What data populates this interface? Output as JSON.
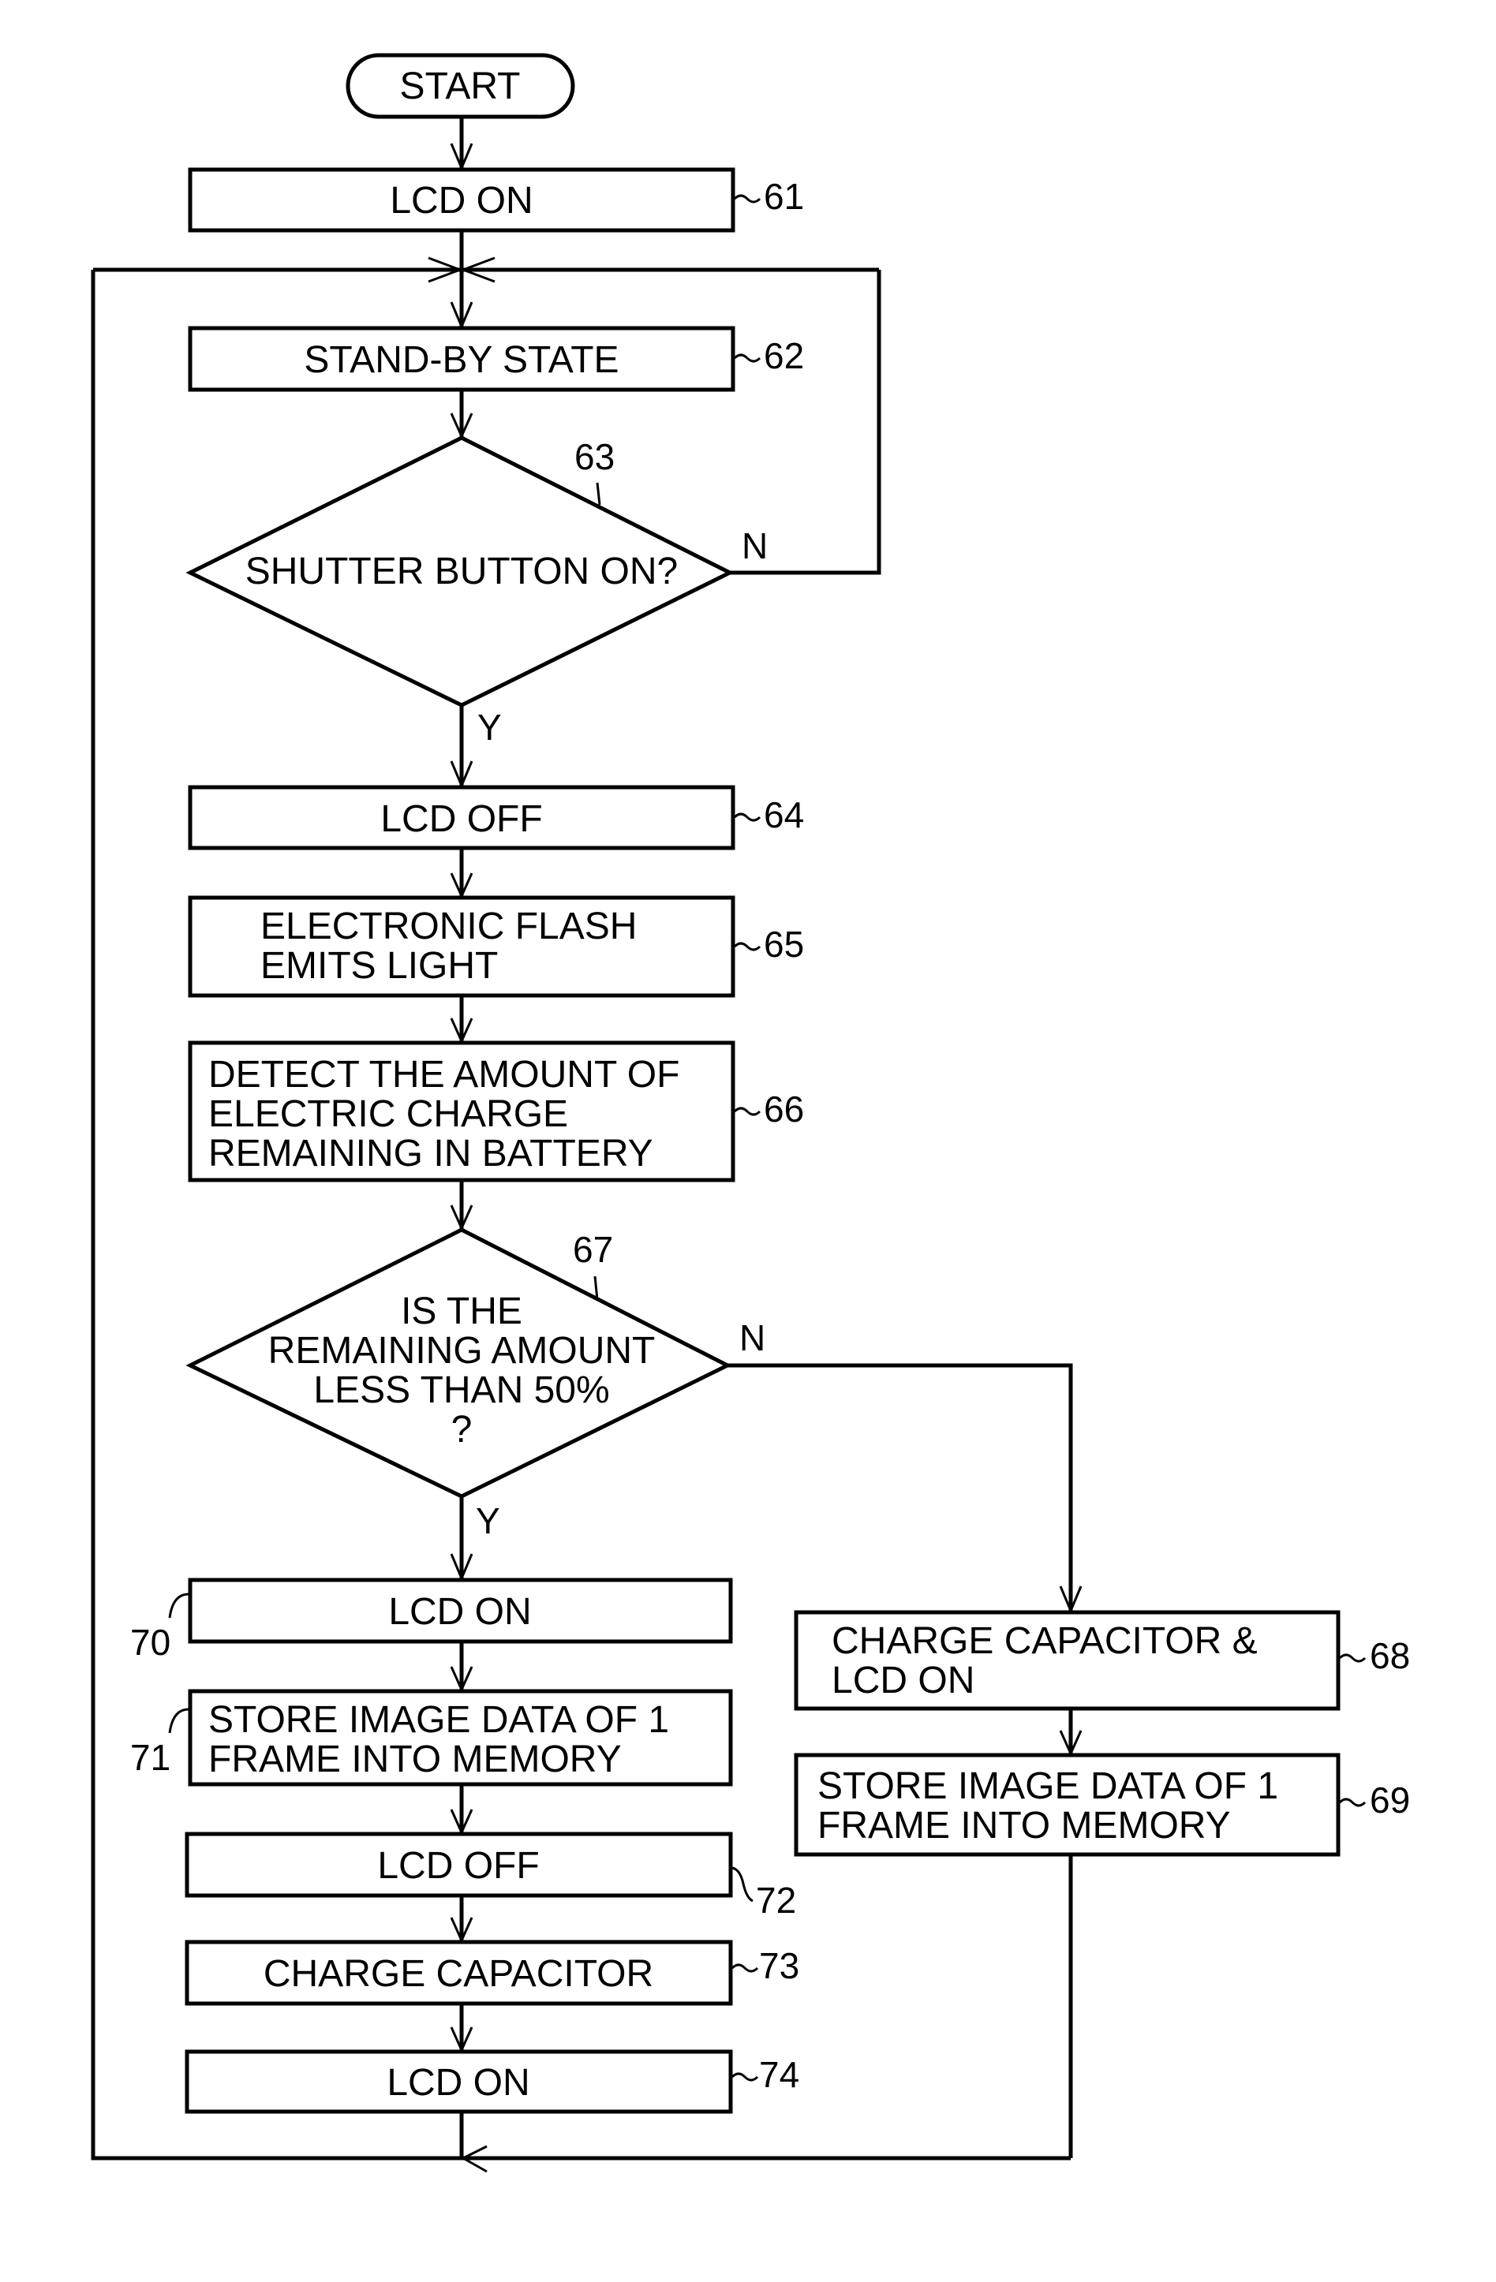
{
  "figure": {
    "type": "flowchart",
    "start": {
      "label": "START"
    },
    "steps": {
      "s61": {
        "ref": "61",
        "lines": [
          "LCD ON"
        ]
      },
      "s62": {
        "ref": "62",
        "lines": [
          "STAND-BY STATE"
        ]
      },
      "s63": {
        "ref": "63",
        "lines": [
          "SHUTTER BUTTON ON?"
        ],
        "yes": "Y",
        "no": "N"
      },
      "s64": {
        "ref": "64",
        "lines": [
          "LCD OFF"
        ]
      },
      "s65": {
        "ref": "65",
        "lines": [
          "ELECTRONIC FLASH",
          "EMITS LIGHT"
        ]
      },
      "s66": {
        "ref": "66",
        "lines": [
          "DETECT THE AMOUNT OF",
          "ELECTRIC CHARGE",
          "REMAINING IN BATTERY"
        ]
      },
      "s67": {
        "ref": "67",
        "lines": [
          "IS THE",
          "REMAINING AMOUNT",
          "LESS THAN 50%",
          "?"
        ],
        "yes": "Y",
        "no": "N"
      },
      "s68": {
        "ref": "68",
        "lines": [
          "CHARGE CAPACITOR &",
          "LCD ON"
        ]
      },
      "s69": {
        "ref": "69",
        "lines": [
          "STORE IMAGE DATA OF 1",
          "FRAME INTO MEMORY"
        ]
      },
      "s70": {
        "ref": "70",
        "lines": [
          "LCD ON"
        ]
      },
      "s71": {
        "ref": "71",
        "lines": [
          "STORE IMAGE DATA OF 1",
          "FRAME INTO MEMORY"
        ]
      },
      "s72": {
        "ref": "72",
        "lines": [
          "LCD OFF"
        ]
      },
      "s73": {
        "ref": "73",
        "lines": [
          "CHARGE CAPACITOR"
        ]
      },
      "s74": {
        "ref": "74",
        "lines": [
          "LCD ON"
        ]
      }
    },
    "edges": [
      {
        "from": "start",
        "to": "s61"
      },
      {
        "from": "s61",
        "to": "s62"
      },
      {
        "from": "s62",
        "to": "s63"
      },
      {
        "from": "s63",
        "to": "s62",
        "label": "N"
      },
      {
        "from": "s63",
        "to": "s64",
        "label": "Y"
      },
      {
        "from": "s64",
        "to": "s65"
      },
      {
        "from": "s65",
        "to": "s66"
      },
      {
        "from": "s66",
        "to": "s67"
      },
      {
        "from": "s67",
        "to": "s70",
        "label": "Y"
      },
      {
        "from": "s67",
        "to": "s68",
        "label": "N"
      },
      {
        "from": "s68",
        "to": "s69"
      },
      {
        "from": "s70",
        "to": "s71"
      },
      {
        "from": "s71",
        "to": "s72"
      },
      {
        "from": "s72",
        "to": "s73"
      },
      {
        "from": "s73",
        "to": "s74"
      },
      {
        "from": "s74",
        "to": "s62"
      },
      {
        "from": "s69",
        "to": "s62"
      }
    ]
  }
}
